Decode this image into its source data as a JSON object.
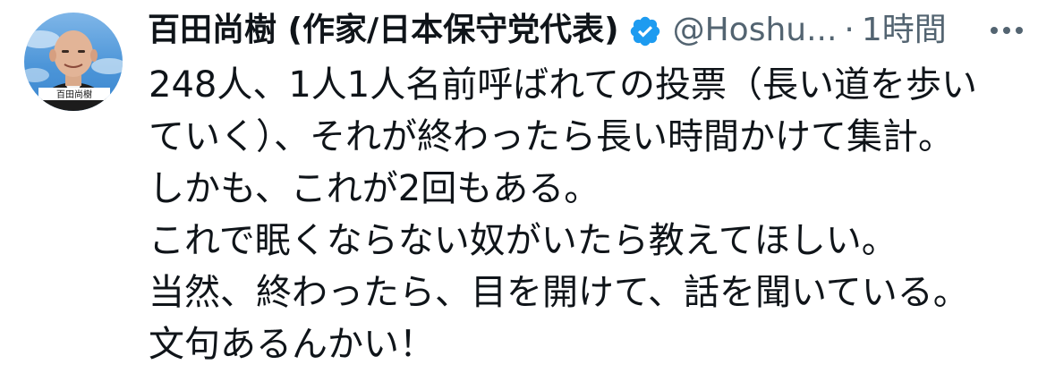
{
  "header": {
    "display_name": "百田尚樹 (作家/日本保守党代表)",
    "handle": "@Hoshu...",
    "separator": "·",
    "time": "1時間",
    "verified_icon": "verified-badge-icon",
    "more_icon": "more-options-icon"
  },
  "avatar": {
    "signature": "百田尚樹"
  },
  "body": {
    "lines": [
      "248人、1人1人名前呼ばれての投票（長い道を歩い",
      "ていく）、それが終わったら長い時間かけて集計。",
      "しかも、これが2回もある。",
      "これで眠くならない奴がいたら教えてほしい。",
      "当然、終わったら、目を開けて、話を聞いている。",
      "文句あるんかい！"
    ]
  },
  "colors": {
    "text": "#0f1419",
    "muted": "#536471",
    "verified": "#1d9bf0",
    "background": "#ffffff"
  }
}
